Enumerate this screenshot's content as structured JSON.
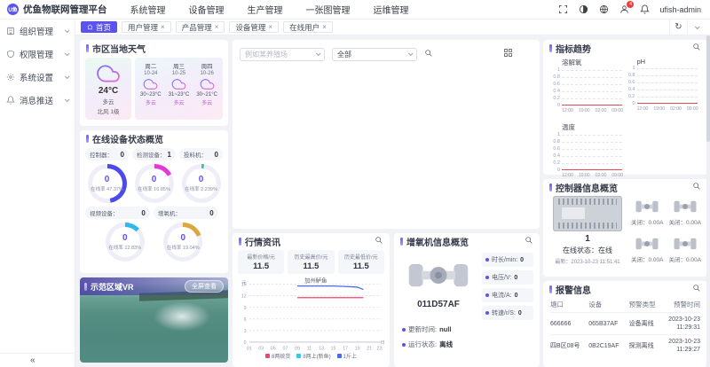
{
  "accent": "#5B53EF",
  "header": {
    "logo_text": "U鱼",
    "app_title": "优鱼物联网管理平台",
    "nav_items": [
      "系统管理",
      "设备管理",
      "生产管理",
      "一张图管理",
      "运维管理"
    ],
    "badge_count": "4",
    "username": "ufish-admin"
  },
  "sidebar": {
    "items": [
      {
        "label": "组织管理"
      },
      {
        "label": "权限管理"
      },
      {
        "label": "系统设置"
      },
      {
        "label": "消息推送"
      }
    ],
    "collapse_label": "«"
  },
  "tabs": {
    "home": "首页",
    "items": [
      "用户管理",
      "产品管理",
      "设备管理",
      "在线用户"
    ]
  },
  "weather": {
    "title": "市区当地天气",
    "current": {
      "temp": "24°C",
      "cond": "多云",
      "wind": "北风 1级"
    },
    "forecast": [
      {
        "day": "周二",
        "date": "10-24",
        "range": "30~23°C",
        "cond": "多云"
      },
      {
        "day": "周三",
        "date": "10-25",
        "range": "31~23°C",
        "cond": "多云"
      },
      {
        "day": "周四",
        "date": "10-26",
        "range": "30~21°C",
        "cond": "多云"
      }
    ]
  },
  "status": {
    "title": "在线设备状态概览",
    "groups": [
      {
        "name": "控制器：",
        "count": "0",
        "value": "0",
        "rate": "在线率 47.37%",
        "pct": 47.37,
        "color": "#4A4AEE"
      },
      {
        "name": "检测设备：",
        "count": "1",
        "value": "0",
        "rate": "在线率 16.85%",
        "pct": 16.85,
        "color": "#E23AD8"
      },
      {
        "name": "投料机：",
        "count": "0",
        "value": "0",
        "rate": "在线率 2.239%",
        "pct": 2.24,
        "color": "#35C9A8"
      },
      {
        "name": "视频设备：",
        "count": "0",
        "value": "0",
        "rate": "在线率 12.83%",
        "pct": 12.83,
        "color": "#2FB8F0"
      },
      {
        "name": "增氧机：",
        "count": "0",
        "value": "0",
        "rate": "在线率 19.04%",
        "pct": 19.04,
        "color": "#DCA63E"
      }
    ]
  },
  "vr": {
    "title": "示范区域VR",
    "button_label": "全屏查看"
  },
  "map": {
    "farm_placeholder": "例如某养殖场",
    "filter_value": "全部"
  },
  "market": {
    "title": "行情资讯",
    "stats": [
      {
        "label": "最新价格/元",
        "value": "11.5"
      },
      {
        "label": "历史最高价/元",
        "value": "11.5"
      },
      {
        "label": "历史最低价/元",
        "value": "11.5"
      }
    ],
    "chart": {
      "type": "line",
      "title": "加州鲈鱼",
      "y_unit": "元",
      "x_unit": "日",
      "ylim": [
        0,
        15
      ],
      "yticks": [
        "15",
        "12",
        "9",
        "6",
        "3",
        "0"
      ],
      "xticks": [
        "01",
        "03",
        "05",
        "07",
        "09",
        "11",
        "13",
        "15",
        "17",
        "19",
        "21",
        "23"
      ],
      "series": [
        {
          "name": "1斤上",
          "color": "#4A69F2",
          "points": [
            [
              9,
              14.5
            ],
            [
              11,
              14.5
            ],
            [
              13,
              14.5
            ],
            [
              15,
              14.5
            ],
            [
              17,
              14.4
            ],
            [
              19,
              14.2
            ],
            [
              20,
              13.6
            ]
          ]
        },
        {
          "name": "8两上(新鱼)",
          "color": "#F0436E",
          "points": [
            [
              9,
              11.5
            ],
            [
              11,
              11.5
            ],
            [
              13,
              11.5
            ],
            [
              15,
              11.5
            ],
            [
              17,
              11.5
            ],
            [
              19,
              11.5
            ],
            [
              20,
              11.5
            ]
          ]
        }
      ],
      "legend": [
        {
          "label": "8两统货",
          "color": "#F0436E"
        },
        {
          "label": "8两上(新鱼)",
          "color": "#37C8F0"
        },
        {
          "label": "1斤上",
          "color": "#4A69F2"
        }
      ]
    }
  },
  "aerator": {
    "title": "增氧机信息概览",
    "device_id": "011D57AF",
    "metrics": [
      {
        "label": "时长/min:",
        "value": "0"
      },
      {
        "label": "电压/V:",
        "value": "0"
      },
      {
        "label": "电流/A:",
        "value": "0"
      },
      {
        "label": "转速/r/S:",
        "value": "0"
      }
    ],
    "update_label": "更新时间:",
    "update_value": "null",
    "status_label": "运行状态:",
    "status_value": "离线"
  },
  "trends": {
    "title": "指标趋势",
    "charts": [
      {
        "name": "溶解氧"
      },
      {
        "name": "pH"
      },
      {
        "name": "温度"
      }
    ],
    "yticks": [
      "1",
      "0.8",
      "0.6",
      "0.4",
      "0.2",
      "0"
    ],
    "xticks": [
      "12:00",
      "19:00",
      "02:00",
      "09:00"
    ],
    "line_color": "#E84855"
  },
  "controller": {
    "title": "控制器信息概览",
    "count": "1",
    "status": "在线状态：在线",
    "latest": "最新：2023-10-23 11:51:41",
    "channels": [
      {
        "state": "关闭：0.00A"
      },
      {
        "state": "关闭：0.00A"
      },
      {
        "state": "关闭：0.00A"
      },
      {
        "state": "关闭：0.00A"
      }
    ]
  },
  "alarms": {
    "title": "报警信息",
    "headers": [
      "塘口",
      "设备",
      "预警类型",
      "预警时间"
    ],
    "rows": [
      {
        "pond": "666666",
        "device": "065B37AF",
        "type": "设备离线",
        "time": "2023-10-23 11:29:31"
      },
      {
        "pond": "四B区08号",
        "device": "0B2C19AF",
        "type": "探测离线",
        "time": "2023-10-23 11:29:27"
      }
    ]
  }
}
